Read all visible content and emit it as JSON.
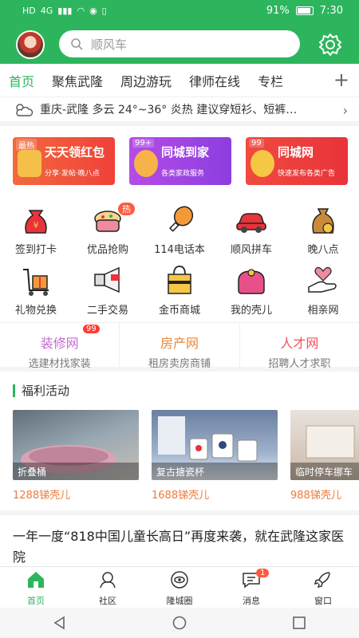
{
  "status_bar": {
    "left": [
      "HD",
      "4G",
      "signal",
      "wifi",
      "eye",
      "vibrate"
    ],
    "battery_pct": "91%",
    "time": "7:30"
  },
  "header": {
    "search_placeholder": "顺风车"
  },
  "tabs": [
    "首页",
    "聚焦武隆",
    "周边游玩",
    "律师在线",
    "专栏"
  ],
  "weather": {
    "text": "重庆-武隆 多云 24°~36° 炎热 建议穿短衫、短裤…"
  },
  "banners": [
    {
      "tag": "最热",
      "title": "天天领红包",
      "sub": "分享·发帖·晚八点",
      "color": "#f0413a"
    },
    {
      "tag": "99+",
      "title": "同城到家",
      "sub": "各类家政服务",
      "color": "#8c3ee0"
    },
    {
      "tag": "99",
      "title": "同城网",
      "sub": "快速发布各类广告",
      "color": "#e8333a"
    }
  ],
  "grid": [
    {
      "label": "签到打卡",
      "icon": "red-bag-icon"
    },
    {
      "label": "优品抢购",
      "icon": "cake-icon",
      "badge": "热"
    },
    {
      "label": "114电话本",
      "icon": "chicken-leg-icon"
    },
    {
      "label": "顺风拼车",
      "icon": "car-icon"
    },
    {
      "label": "晚八点",
      "icon": "money-bag-icon"
    },
    {
      "label": "礼物兑换",
      "icon": "gift-cart-icon"
    },
    {
      "label": "二手交易",
      "icon": "megaphone-icon"
    },
    {
      "label": "金币商城",
      "icon": "shopping-bag-icon"
    },
    {
      "label": "我的壳儿",
      "icon": "wallet-icon"
    },
    {
      "label": "相亲网",
      "icon": "hand-heart-icon"
    }
  ],
  "links": [
    {
      "title": "装修网",
      "sub": "选建材找家装",
      "color": "#c46bd6",
      "badge": "99"
    },
    {
      "title": "房产网",
      "sub": "租房卖房商铺",
      "color": "#e8873a"
    },
    {
      "title": "人才网",
      "sub": "招聘人才求职",
      "color": "#f0525a"
    }
  ],
  "welfare": {
    "title": "福利活动",
    "items": [
      {
        "caption": "折叠桶",
        "price": "1288锑壳儿"
      },
      {
        "caption": "复古搪瓷杯",
        "price": "1688锑壳儿"
      },
      {
        "caption": "临时停车挪车",
        "price": "988锑壳儿"
      }
    ]
  },
  "article": {
    "title": "一年一度“818中国儿童长高日”再度来袭，就在武隆这家医院"
  },
  "bottom_nav": [
    {
      "label": "首页",
      "icon": "home-icon",
      "active": true
    },
    {
      "label": "社区",
      "icon": "community-icon"
    },
    {
      "label": "隆城圈",
      "icon": "circle-eye-icon"
    },
    {
      "label": "消息",
      "icon": "message-icon",
      "badge": "1"
    },
    {
      "label": "窗口",
      "icon": "rocket-icon"
    }
  ],
  "colors": {
    "brand": "#2db55d",
    "accent": "#f07a3a"
  }
}
